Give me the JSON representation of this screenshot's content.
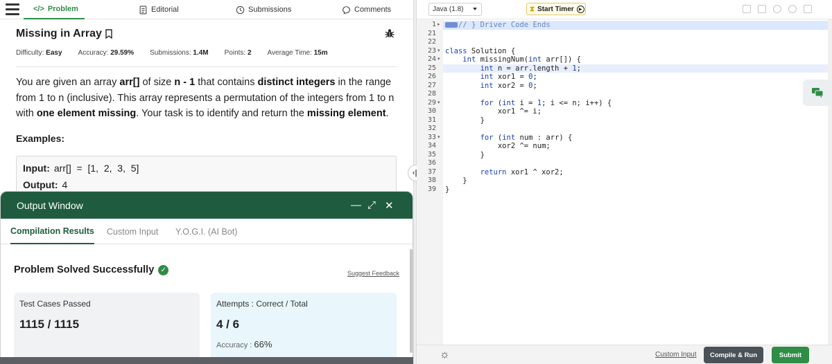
{
  "nav": {
    "tabs": [
      {
        "label": "Problem",
        "icon": "code-icon",
        "active": true
      },
      {
        "label": "Editorial",
        "icon": "document-icon"
      },
      {
        "label": "Submissions",
        "icon": "clock-icon"
      },
      {
        "label": "Comments",
        "icon": "comment-icon"
      }
    ]
  },
  "problem": {
    "title": "Missing in Array",
    "meta": {
      "difficulty_label": "Difficulty:",
      "difficulty": "Easy",
      "accuracy_label": "Accuracy:",
      "accuracy": "29.59%",
      "submissions_label": "Submissions:",
      "submissions": "1.4M",
      "points_label": "Points:",
      "points": "2",
      "avg_time_label": "Average Time:",
      "avg_time": "15m"
    },
    "description": {
      "t1": "You are given an array ",
      "b1": "arr[]",
      "t2": " of size ",
      "b2": "n - 1",
      "t3": " that contains ",
      "b3": "distinct integers",
      "t4": " in the range from 1 to n (inclusive). This array represents a permutation of the integers from 1 to n with ",
      "b4": "one element missing",
      "t5": ". Your task is to identify and return the ",
      "b5": "missing element",
      "t6": "."
    },
    "examples_heading": "Examples:",
    "example": {
      "input_label": "Input:",
      "input_value": "arr[]  =  [1,  2,  3,  5]",
      "output_label": "Output:",
      "output_value": "4"
    }
  },
  "output_window": {
    "title": "Output Window",
    "minimize": "—",
    "expand": "⤢",
    "close": "✕",
    "tabs": [
      {
        "label": "Compilation Results",
        "active": true
      },
      {
        "label": "Custom Input"
      },
      {
        "label": "Y.O.G.I. (AI Bot)"
      }
    ],
    "status": "Problem Solved Successfully",
    "feedback": "Suggest Feedback",
    "test_cases_label": "Test Cases Passed",
    "test_cases_value": "1115 / 1115",
    "attempts_label": "Attempts : Correct / Total",
    "attempts_value": "4 / 6",
    "accuracy_label": "Accuracy :",
    "accuracy_value": "66%"
  },
  "editor": {
    "language": "Java (1.8)",
    "timer_label": "Start Timer",
    "custom_input": "Custom Input",
    "compile_run": "Compile & Run",
    "submit": "Submit",
    "lines": [
      {
        "n": "1",
        "fold": "▸",
        "code": "// } Driver Code Ends",
        "badge": true
      },
      {
        "n": "21",
        "code": ""
      },
      {
        "n": "22",
        "code": ""
      },
      {
        "n": "23",
        "fold": "▾",
        "code": "class Solution {"
      },
      {
        "n": "24",
        "fold": "▾",
        "code": "    int missingNum(int arr[]) {"
      },
      {
        "n": "25",
        "code": "        int n = arr.length + 1;"
      },
      {
        "n": "26",
        "code": "        int xor1 = 0;"
      },
      {
        "n": "27",
        "code": "        int xor2 = 0;"
      },
      {
        "n": "28",
        "code": ""
      },
      {
        "n": "29",
        "fold": "▾",
        "code": "        for (int i = 1; i <= n; i++) {"
      },
      {
        "n": "30",
        "code": "            xor1 ^= i;"
      },
      {
        "n": "31",
        "code": "        }"
      },
      {
        "n": "32",
        "code": ""
      },
      {
        "n": "33",
        "fold": "▾",
        "code": "        for (int num : arr) {"
      },
      {
        "n": "34",
        "code": "            xor2 ^= num;"
      },
      {
        "n": "35",
        "code": "        }"
      },
      {
        "n": "36",
        "code": ""
      },
      {
        "n": "37",
        "code": "        return xor1 ^ xor2;"
      },
      {
        "n": "38",
        "code": "    }"
      },
      {
        "n": "39",
        "code": "}"
      }
    ]
  },
  "colors": {
    "brand_green": "#2f8d46",
    "output_header": "#1f5c3f",
    "card_gray": "#f1f2f4",
    "card_blue": "#e9f6fb"
  }
}
